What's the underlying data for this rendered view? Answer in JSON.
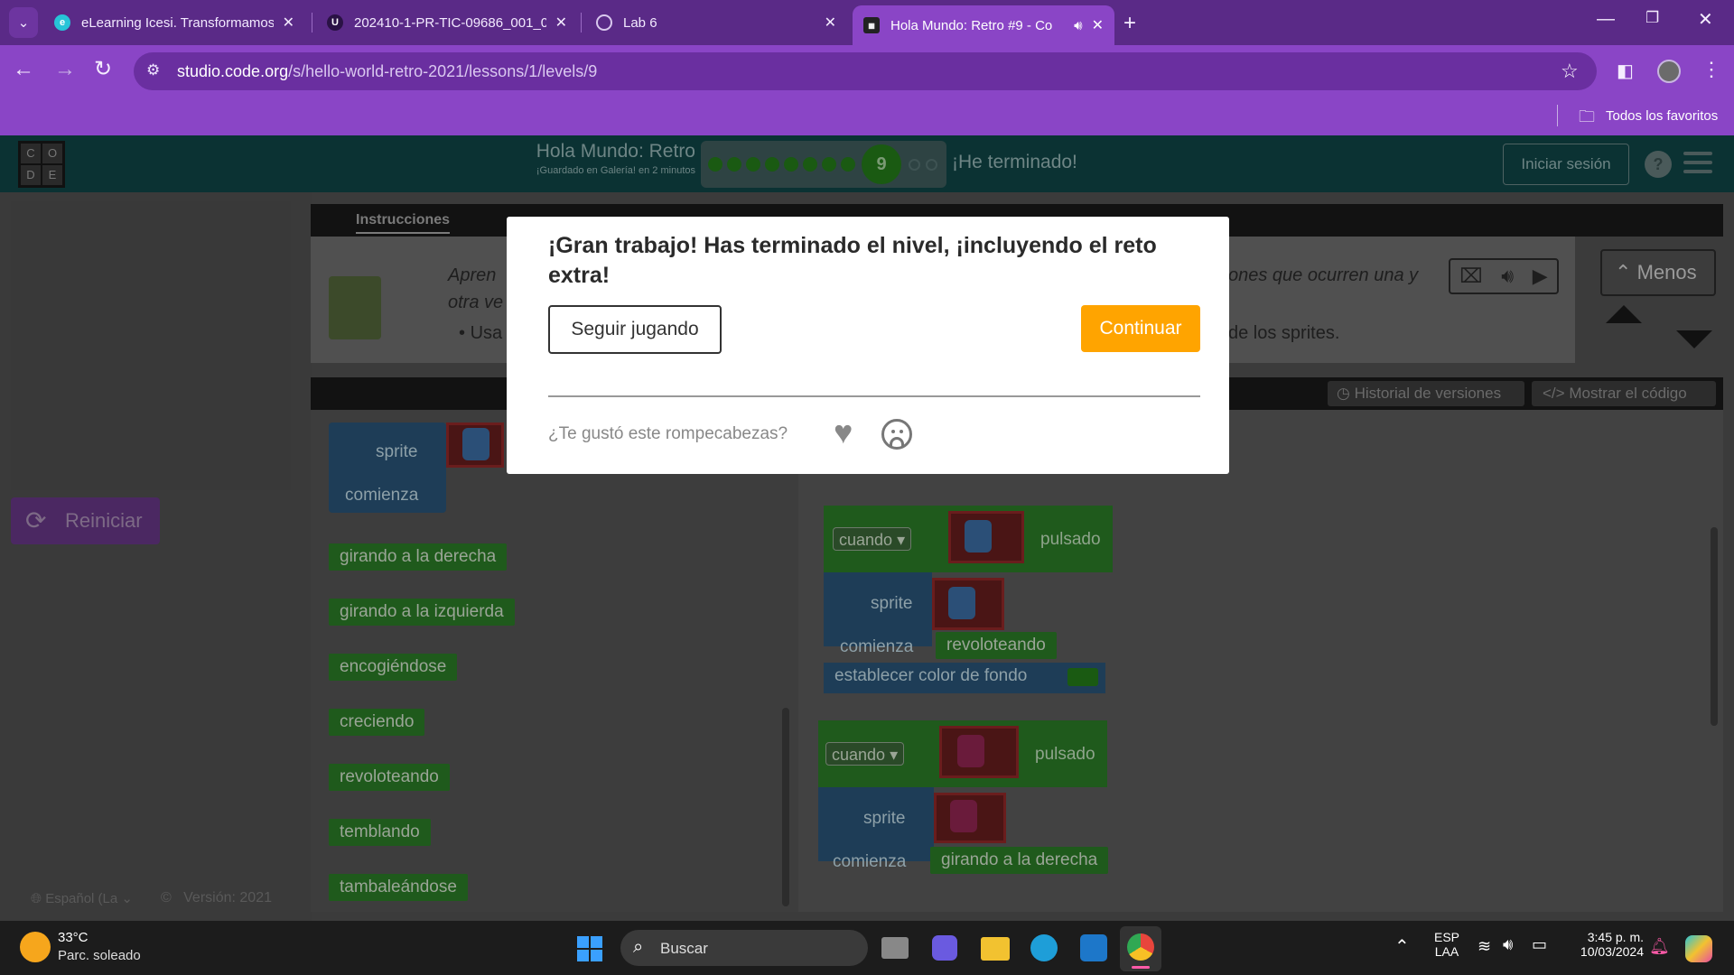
{
  "browser": {
    "tabs": [
      {
        "title": "eLearning Icesi. Transformamos",
        "favicon": "elearning-icon",
        "active": false
      },
      {
        "title": "202410-1-PR-TIC-09686_001_0",
        "favicon": "u-icon",
        "active": false
      },
      {
        "title": "Lab 6",
        "favicon": "globe-icon",
        "active": false
      },
      {
        "title": "Hola Mundo: Retro #9 - Co",
        "favicon": "code-org-icon",
        "active": true
      }
    ],
    "url_host": "studio.code.org",
    "url_path": "/s/hello-world-retro-2021/lessons/1/levels/9",
    "bookmarks_label": "Todos los favoritos"
  },
  "site": {
    "logo_letters": [
      "C",
      "O",
      "D",
      "E"
    ],
    "course_title": "Hola Mundo: Retro",
    "saved_note": "¡Guardado en Galería! en 2 minutos",
    "current_level": "9",
    "progress_filled": 8,
    "progress_empty": 2,
    "finished_label": "¡He terminado!",
    "login_label": "Iniciar sesión",
    "help_glyph": "?"
  },
  "instructions": {
    "tab_label": "Instrucciones",
    "text_left_1": "Apren",
    "text_left_2": "otra ve",
    "bullet_left": "Usa",
    "text_right_1": "ones que ocurren una y",
    "bullet_right": "de los sprites.",
    "less_label": "Menos"
  },
  "left": {
    "reset_label": "Reiniciar",
    "language_label": "Español (La",
    "version_label": "Versión: 2021"
  },
  "workspace": {
    "history_label": "Historial de versiones",
    "show_code_label": "Mostrar el código",
    "toolbox_sprite_label": "sprite",
    "toolbox_starts_label": "comienza",
    "toolbox_blocks": [
      "girando a la derecha",
      "girando a la izquierda",
      "encogiéndose",
      "creciendo",
      "revoloteando",
      "temblando",
      "tambaleándose"
    ],
    "event1": {
      "when": "cuando",
      "pressed": "pulsado",
      "sprite": "sprite",
      "starts": "comienza",
      "behavior": "revoloteando",
      "bg": "establecer color de fondo"
    },
    "event2": {
      "when": "cuando",
      "pressed": "pulsado",
      "sprite": "sprite",
      "starts": "comienza",
      "behavior": "girando a la derecha"
    }
  },
  "modal": {
    "title": "¡Gran trabajo! Has terminado el nivel, ¡incluyendo el reto extra!",
    "keep_playing_label": "Seguir jugando",
    "continue_label": "Continuar",
    "feedback_question": "¿Te gustó este rompecabezas?",
    "accent_color": "#ffa400"
  },
  "taskbar": {
    "temperature": "33°C",
    "weather": "Parc. soleado",
    "search_label": "Buscar",
    "lang_top": "ESP",
    "lang_bottom": "LAA",
    "time": "3:45 p. m.",
    "date": "10/03/2024"
  }
}
